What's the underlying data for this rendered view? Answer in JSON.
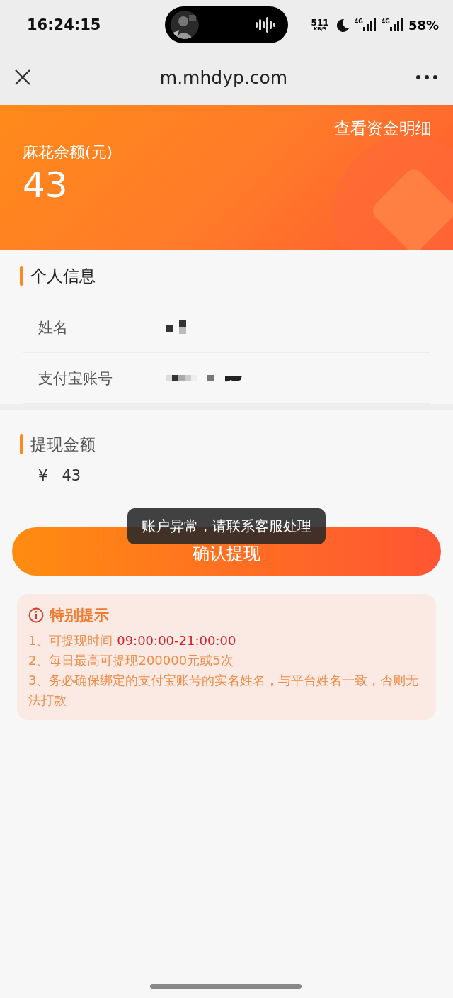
{
  "status_bar": {
    "time": "16:24:15",
    "net_speed": "511",
    "net_unit": "KB/S",
    "sim1": "4G",
    "sim2": "4G",
    "battery": "58%"
  },
  "nav": {
    "title": "m.mhdyp.com"
  },
  "banner": {
    "link": "查看资金明细",
    "label": "麻花余额(元)",
    "amount": "43"
  },
  "personal": {
    "title": "个人信息",
    "rows": [
      {
        "label": "姓名",
        "masked": true
      },
      {
        "label": "支付宝账号",
        "masked": true
      }
    ]
  },
  "withdraw": {
    "title": "提现金额",
    "currency": "¥",
    "amount": "43"
  },
  "confirm_button": {
    "label": "确认提现"
  },
  "toast": {
    "text": "账户异常，请联系客服处理"
  },
  "tips": {
    "title": "特别提示",
    "items": [
      {
        "text": "1、可提现时间 ",
        "highlight": "09:00:00-21:00:00"
      },
      {
        "text": "2、每日最高可提现200000元或5次"
      },
      {
        "text": "3、务必确保绑定的支付宝账号的实名姓名，与平台姓名一致，否则无法打款"
      }
    ]
  }
}
